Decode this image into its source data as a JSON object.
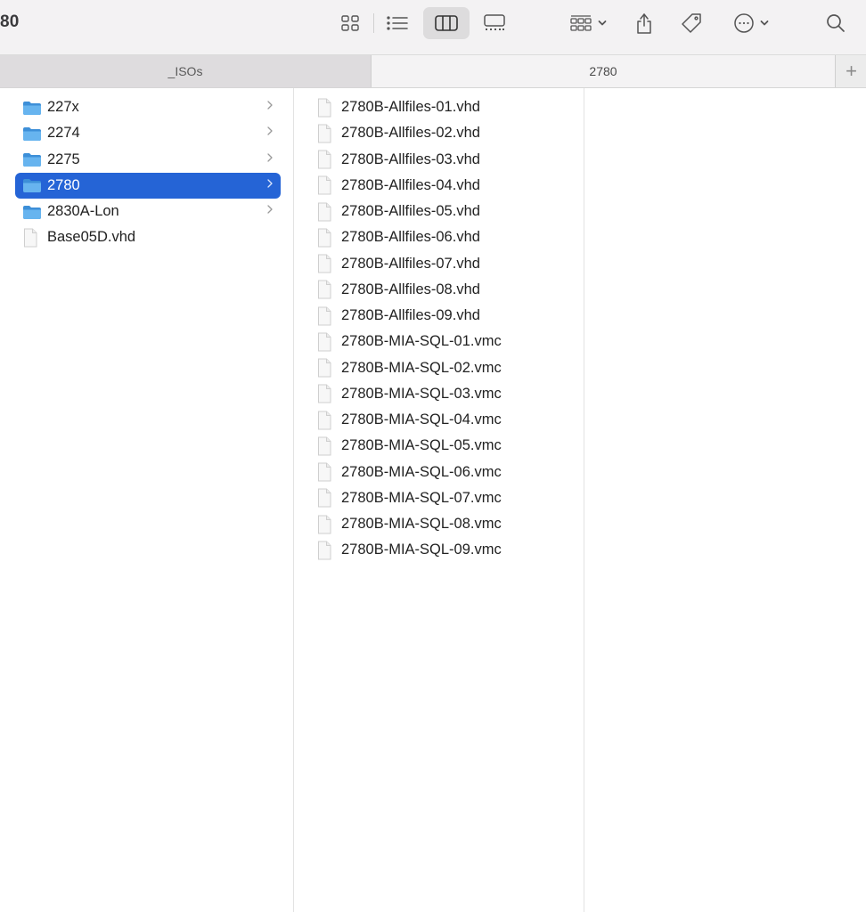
{
  "window": {
    "title": "80"
  },
  "toolbar": {
    "view_icons": "icon-view-icon",
    "view_list": "list-view-icon",
    "view_columns": "column-view-icon",
    "view_gallery": "gallery-view-icon",
    "group": "group-by-icon",
    "share": "share-icon",
    "tag": "tag-icon",
    "more": "more-actions-icon",
    "search": "search-icon"
  },
  "tabs": [
    {
      "label": "_ISOs",
      "active": false
    },
    {
      "label": "2780",
      "active": true
    }
  ],
  "tab_add": "+",
  "columns": {
    "first": [
      {
        "label": "227x",
        "kind": "folder",
        "has_children": true,
        "selected": false
      },
      {
        "label": "2274",
        "kind": "folder",
        "has_children": true,
        "selected": false
      },
      {
        "label": "2275",
        "kind": "folder",
        "has_children": true,
        "selected": false
      },
      {
        "label": "2780",
        "kind": "folder",
        "has_children": true,
        "selected": true
      },
      {
        "label": "2830A-Lon",
        "kind": "folder",
        "has_children": true,
        "selected": false
      },
      {
        "label": "Base05D.vhd",
        "kind": "file",
        "has_children": false,
        "selected": false
      }
    ],
    "second": [
      {
        "label": "2780B-Allfiles-01.vhd",
        "kind": "file"
      },
      {
        "label": "2780B-Allfiles-02.vhd",
        "kind": "file"
      },
      {
        "label": "2780B-Allfiles-03.vhd",
        "kind": "file"
      },
      {
        "label": "2780B-Allfiles-04.vhd",
        "kind": "file"
      },
      {
        "label": "2780B-Allfiles-05.vhd",
        "kind": "file"
      },
      {
        "label": "2780B-Allfiles-06.vhd",
        "kind": "file"
      },
      {
        "label": "2780B-Allfiles-07.vhd",
        "kind": "file"
      },
      {
        "label": "2780B-Allfiles-08.vhd",
        "kind": "file"
      },
      {
        "label": "2780B-Allfiles-09.vhd",
        "kind": "file"
      },
      {
        "label": "2780B-MIA-SQL-01.vmc",
        "kind": "file"
      },
      {
        "label": "2780B-MIA-SQL-02.vmc",
        "kind": "file"
      },
      {
        "label": "2780B-MIA-SQL-03.vmc",
        "kind": "file"
      },
      {
        "label": "2780B-MIA-SQL-04.vmc",
        "kind": "file"
      },
      {
        "label": "2780B-MIA-SQL-05.vmc",
        "kind": "file"
      },
      {
        "label": "2780B-MIA-SQL-06.vmc",
        "kind": "file"
      },
      {
        "label": "2780B-MIA-SQL-07.vmc",
        "kind": "file"
      },
      {
        "label": "2780B-MIA-SQL-08.vmc",
        "kind": "file"
      },
      {
        "label": "2780B-MIA-SQL-09.vmc",
        "kind": "file"
      }
    ]
  },
  "colors": {
    "selection": "#2564d6",
    "folder": "#5aa8e8",
    "toolbar_bg": "#f3f2f3"
  }
}
